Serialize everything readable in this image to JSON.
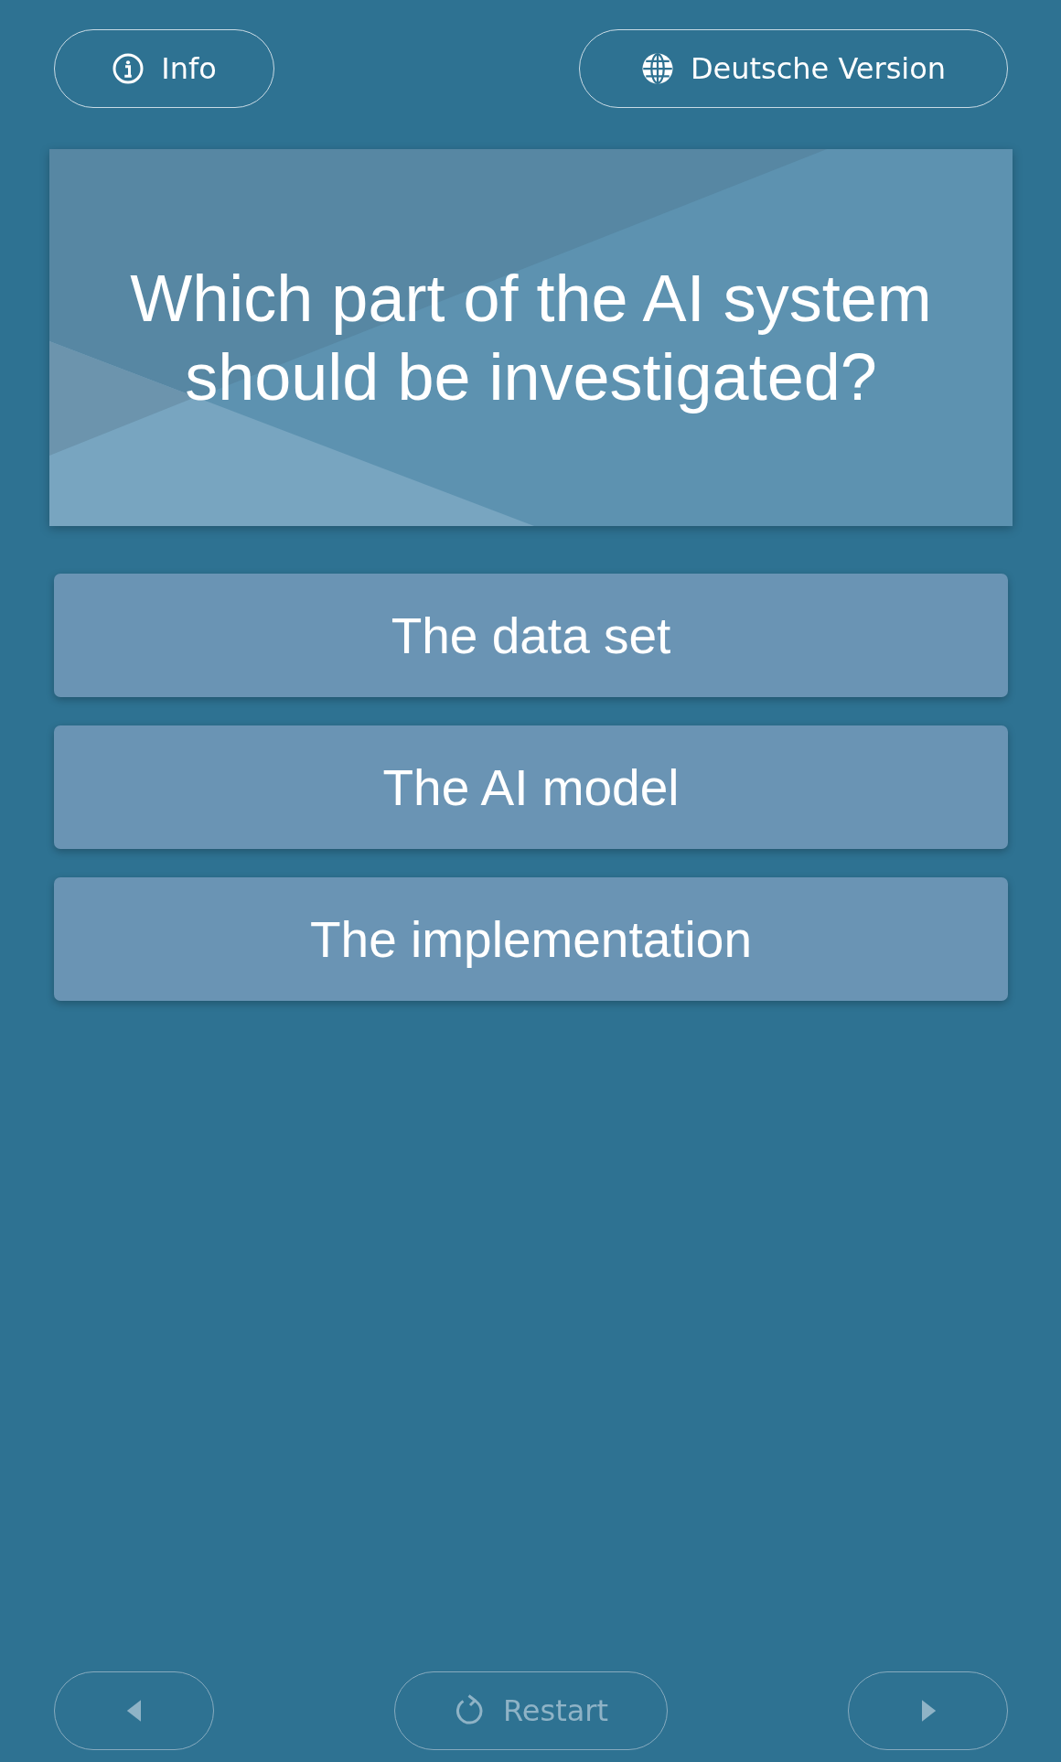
{
  "header": {
    "info_button": {
      "label": "Info"
    },
    "language_button": {
      "label": "Deutsche Version"
    }
  },
  "question": {
    "text": "Which part of the AI system should be investigated?"
  },
  "answers": [
    {
      "label": "The data set",
      "selected": false
    },
    {
      "label": "The AI model",
      "selected": false
    },
    {
      "label": "The implementation",
      "selected": false
    }
  ],
  "footer": {
    "back_button": {
      "disabled": true
    },
    "restart_button": {
      "label": "Restart",
      "disabled": true
    },
    "next_button": {
      "disabled": true
    }
  }
}
